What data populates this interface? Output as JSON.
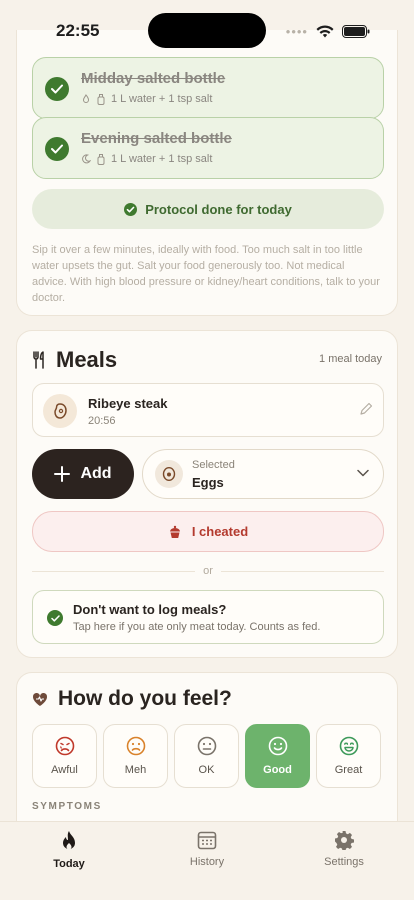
{
  "status_bar": {
    "time": "22:55"
  },
  "protocol": {
    "bottles": [
      {
        "title": "Midday salted bottle",
        "detail": "1 L water + 1 tsp salt",
        "time_icon": "sun-icon"
      },
      {
        "title": "Evening salted bottle",
        "detail": "1 L water + 1 tsp salt",
        "time_icon": "moon-icon"
      }
    ],
    "done_label": "Protocol done for today",
    "note": "Sip it over a few minutes, ideally with food. Too much salt in too little water upsets the gut. Salt your food generously too. Not medical advice. With high blood pressure or kidney/heart conditions, talk to your doctor."
  },
  "meals": {
    "title": "Meals",
    "count": "1 meal today",
    "items": [
      {
        "name": "Ribeye steak",
        "time": "20:56"
      }
    ],
    "add_label": "Add",
    "select_caption": "Selected",
    "select_value": "Eggs",
    "cheat_label": "I cheated",
    "or_label": "or",
    "no_log_title": "Don't want to log meals?",
    "no_log_sub": "Tap here if you ate only meat today. Counts as fed."
  },
  "feel": {
    "title": "How do you feel?",
    "moods": [
      {
        "label": "Awful",
        "color": "#c0392b"
      },
      {
        "label": "Meh",
        "color": "#d9822b"
      },
      {
        "label": "OK",
        "color": "#7a736a"
      },
      {
        "label": "Good",
        "color": "#ffffff"
      },
      {
        "label": "Great",
        "color": "#3d9a5a"
      }
    ],
    "selected": "Good",
    "symptoms_label": "SYMPTOMS"
  },
  "tabs": [
    {
      "label": "Today",
      "icon": "flame-icon",
      "active": true
    },
    {
      "label": "History",
      "icon": "calendar-icon",
      "active": false
    },
    {
      "label": "Settings",
      "icon": "gear-icon",
      "active": false
    }
  ]
}
